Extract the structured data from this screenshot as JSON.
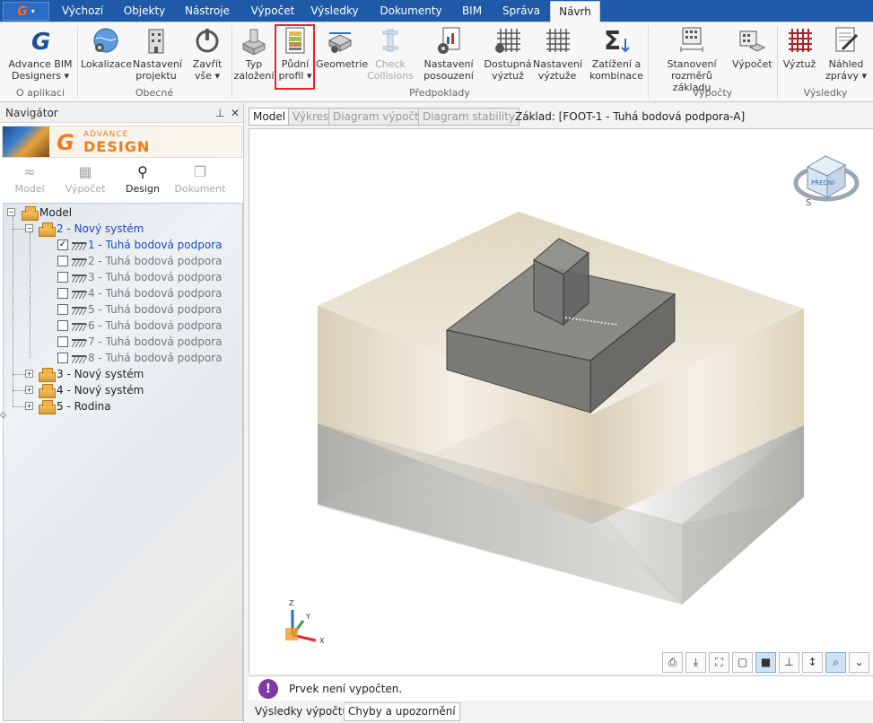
{
  "app": {
    "logo": "G"
  },
  "tabs": [
    "Výchozí",
    "Objekty",
    "Nástroje",
    "Výpočet",
    "Výsledky",
    "Dokumenty",
    "BIM",
    "Správa",
    "Návrh"
  ],
  "active_tab": "Návrh",
  "ribbon": {
    "groups": {
      "about": "O aplikaci",
      "general": "Obecné",
      "assumptions": "Předpoklady",
      "calculations": "Výpočty",
      "results": "Výsledky"
    },
    "buttons": {
      "advance_bim": "Advance BIM Designers",
      "localize": "Lokalizace",
      "project_settings": "Nastavení projektu",
      "close_all": "Zavřít vše",
      "foundation_type": "Typ založení",
      "soil_profile": "Půdní profil",
      "geometry": "Geometrie",
      "check_collisions": "Check Collisions",
      "assessment_settings": "Nastavení posouzení",
      "available_reinf": "Dostupná výztuž",
      "reinf_settings": "Nastavení výztuže",
      "loads_combinations": "Zatížení a kombinace",
      "foundation_dims": "Stanovení rozměrů základu",
      "calculation": "Výpočet",
      "reinforcement": "Výztuž",
      "report_preview": "Náhled zprávy"
    }
  },
  "navigator": {
    "title": "Navigátor",
    "pin": "⊥",
    "close": "✕",
    "banner": {
      "g": "G",
      "advance": "ADVANCE",
      "design": "DESIGN"
    },
    "modes": [
      "Model",
      "Výpočet",
      "Design",
      "Dokument"
    ],
    "active_mode": "Design",
    "tree": {
      "root": "Model",
      "system2": "2 - Nový systém",
      "supports": [
        "1 - Tuhá bodová podpora",
        "2 - Tuhá bodová podpora",
        "3 - Tuhá bodová podpora",
        "4 - Tuhá bodová podpora",
        "5 - Tuhá bodová podpora",
        "6 - Tuhá bodová podpora",
        "7 - Tuhá bodová podpora",
        "8 - Tuhá bodová podpora"
      ],
      "checked_support": "1 - Tuhá bodová podpora",
      "system3": "3 - Nový systém",
      "system4": "4 - Nový systém",
      "family5": "5 - Rodina"
    }
  },
  "view": {
    "tabs": [
      "Model",
      "Výkres",
      "Diagram výpočtu",
      "Diagram stability"
    ],
    "base_label": "Základ: [FOOT-1 - Tuhá bodová podpora-A]",
    "cube": {
      "front": "PŘEDNÍ",
      "s": "S"
    },
    "axes": {
      "z": "Z",
      "y": "Y",
      "x": "X"
    },
    "buttons": [
      "print-icon",
      "download-icon",
      "fit-icon",
      "box-view-icon",
      "solid-view-icon",
      "axis-icon",
      "dimension-icon",
      "zoom-icon",
      "expand-icon"
    ]
  },
  "status": {
    "message": "Prvek není vypočten."
  },
  "bottom_tabs": [
    "Výsledky výpočtu",
    "Chyby a upozornění"
  ],
  "colors": {
    "tabbar": "#1e5aa8",
    "highlight": "#e0282d",
    "tree_blue": "#1a49c4",
    "brand_orange": "#f07c1a"
  }
}
